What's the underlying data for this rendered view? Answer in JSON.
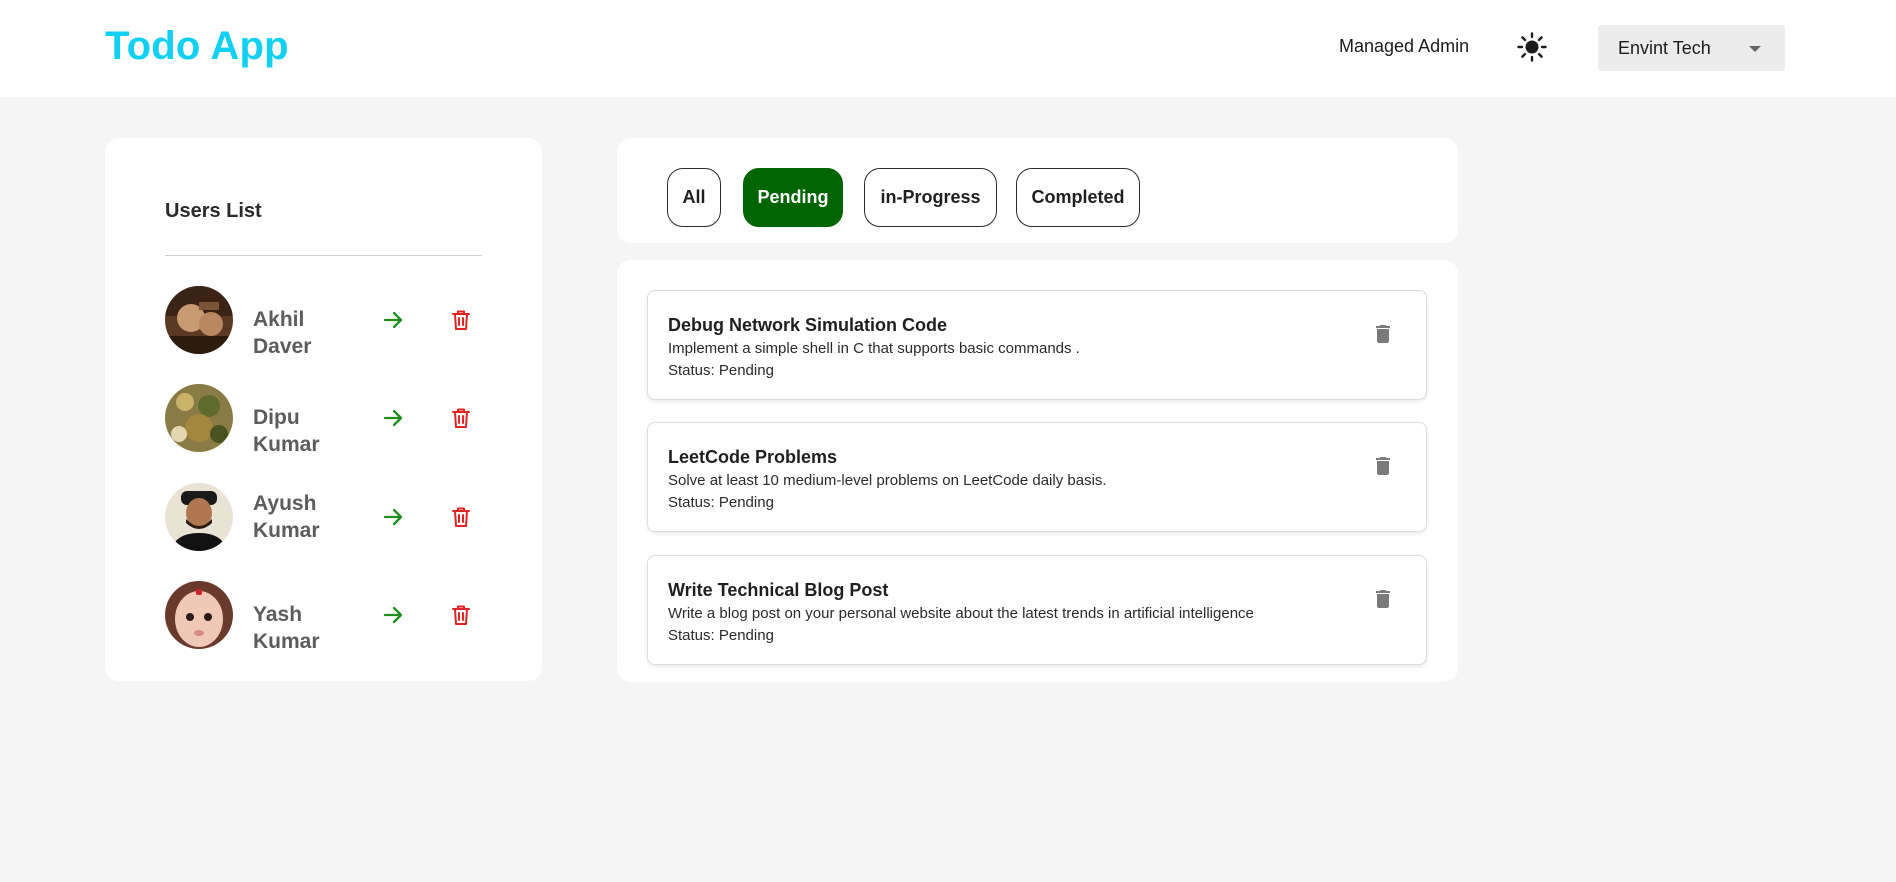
{
  "header": {
    "brand": "Todo App",
    "user_label": "Managed Admin",
    "org_select": {
      "selected": "Envint Tech"
    }
  },
  "colors": {
    "brand": "#12d0f3",
    "active_filter": "#006400",
    "go_arrow": "#1e8f1e",
    "danger": "#e02424",
    "task_trash": "#7a7a7a"
  },
  "users": {
    "title": "Users List",
    "items": [
      {
        "name": "Akhil Daver"
      },
      {
        "name": "Dipu Kumar"
      },
      {
        "name": "Ayush Kumar"
      },
      {
        "name": "Yash Kumar"
      }
    ]
  },
  "filters": {
    "active": "Pending",
    "items": [
      {
        "label": "All"
      },
      {
        "label": "Pending"
      },
      {
        "label": "in-Progress"
      },
      {
        "label": "Completed"
      }
    ]
  },
  "tasks": [
    {
      "title": "Debug Network Simulation Code",
      "description": "Implement a simple shell in C that supports basic commands .",
      "status": "Status: Pending"
    },
    {
      "title": "LeetCode Problems",
      "description": "Solve at least 10 medium-level problems on LeetCode daily basis.",
      "status": "Status: Pending"
    },
    {
      "title": "Write Technical Blog Post",
      "description": "Write a blog post on your personal website about the latest trends in artificial intelligence",
      "status": "Status: Pending"
    }
  ],
  "icons": {
    "theme": "sun-icon",
    "org_caret": "chevron-down-icon",
    "user_go": "arrow-right-icon",
    "user_delete": "trash-outline-icon",
    "task_delete": "trash-icon"
  }
}
